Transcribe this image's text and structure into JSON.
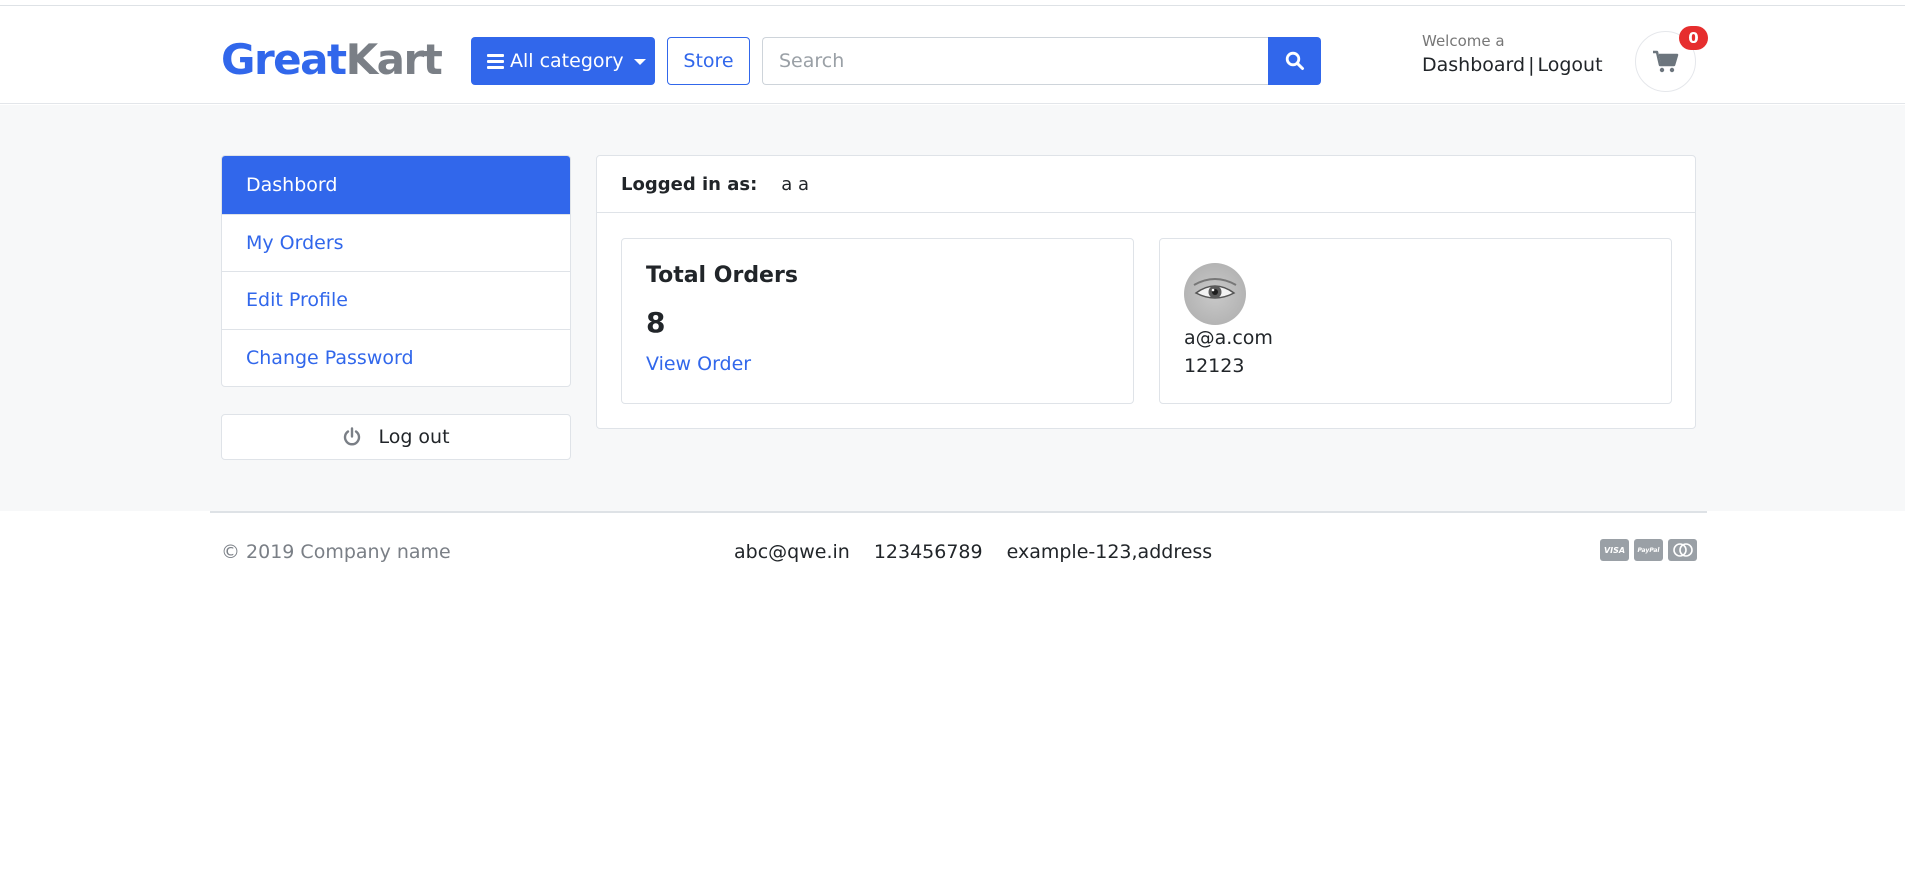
{
  "header": {
    "logo_part1": "Great",
    "logo_part2": "Kart",
    "category_label": "All category",
    "store_label": "Store",
    "search_placeholder": "Search",
    "welcome_text": "Welcome a",
    "dashboard_link": "Dashboard",
    "separator": "|",
    "logout_link": "Logout",
    "cart_count": "0"
  },
  "sidebar": {
    "items": [
      {
        "label": "Dashbord",
        "active": true
      },
      {
        "label": "My Orders",
        "active": false
      },
      {
        "label": "Edit Profile",
        "active": false
      },
      {
        "label": "Change Password",
        "active": false
      }
    ],
    "logout_label": "Log out"
  },
  "panel": {
    "logged_in_label": "Logged in as:",
    "logged_in_value": "a a",
    "orders_card": {
      "title": "Total Orders",
      "count": "8",
      "link": "View Order"
    },
    "profile_card": {
      "email": "a@a.com",
      "phone": "12123"
    }
  },
  "footer": {
    "copyright": "© 2019 Company name",
    "email": "abc@qwe.in",
    "phone": "123456789",
    "address": "example-123,address",
    "payments": [
      "VISA",
      "PayPal",
      "mastercard"
    ]
  },
  "colors": {
    "primary": "#3167eb",
    "badge": "#e62e2e",
    "muted": "#7a7f86",
    "background": "#f7f8f9"
  }
}
